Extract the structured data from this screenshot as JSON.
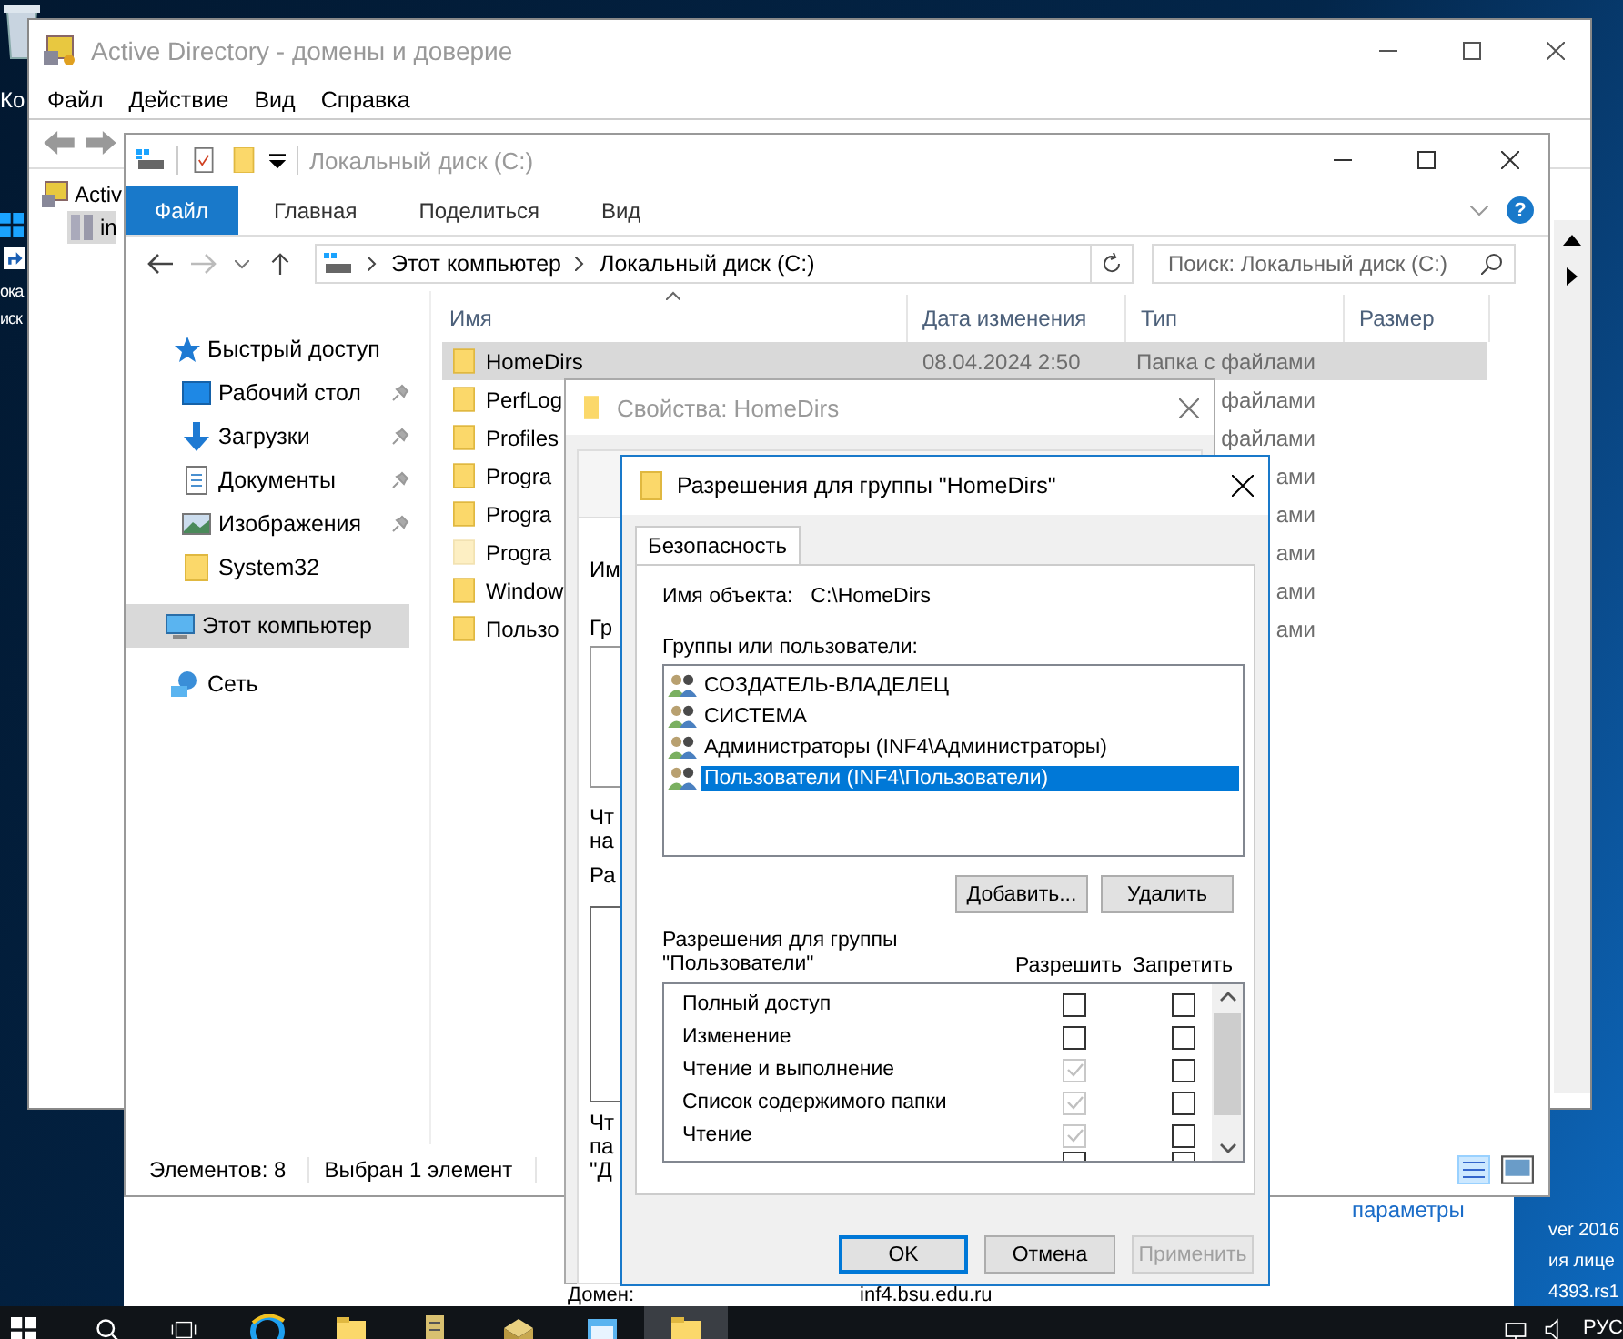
{
  "desktop": {
    "icon_labels": [
      "Ко",
      "ока",
      "иск"
    ],
    "system_text": [
      "ver 2016",
      "ия лице",
      "4393.rs1"
    ]
  },
  "ad_window": {
    "title": "Active Directory - домены и доверие",
    "menu": [
      "Файл",
      "Действие",
      "Вид",
      "Справка"
    ],
    "tree": [
      {
        "label": "Activ",
        "selected": false,
        "children": [
          {
            "label": "in",
            "selected": true
          }
        ]
      }
    ]
  },
  "back_window": {
    "link": "параметры",
    "fields": [
      {
        "label": "Домен:",
        "value": "inf4.bsu.edu.ru"
      }
    ]
  },
  "explorer": {
    "title": "Локальный диск (C:)",
    "ribbon_tabs": [
      {
        "label": "Файл",
        "selected": true
      },
      {
        "label": "Главная",
        "selected": false
      },
      {
        "label": "Поделиться",
        "selected": false
      },
      {
        "label": "Вид",
        "selected": false
      }
    ],
    "help": "?",
    "breadcrumb": [
      "Этот компьютер",
      "Локальный диск (C:)"
    ],
    "search": {
      "placeholder": "Поиск: Локальный диск (C:)"
    },
    "nav": [
      {
        "label": "Быстрый доступ",
        "kind": "star",
        "selected": false,
        "children": [
          {
            "label": "Рабочий стол",
            "kind": "desktop",
            "pinned": true
          },
          {
            "label": "Загрузки",
            "kind": "download",
            "pinned": true
          },
          {
            "label": "Документы",
            "kind": "documents",
            "pinned": true
          },
          {
            "label": "Изображения",
            "kind": "pictures",
            "pinned": true
          },
          {
            "label": "System32",
            "kind": "folder",
            "pinned": false
          }
        ]
      },
      {
        "label": "Этот компьютер",
        "kind": "computer",
        "selected": true
      },
      {
        "label": "Сеть",
        "kind": "network",
        "selected": false
      }
    ],
    "columns": [
      "Имя",
      "Дата изменения",
      "Тип",
      "Размер"
    ],
    "files": [
      {
        "name": "HomeDirs",
        "date": "08.04.2024 2:50",
        "type": "Папка с файлами",
        "selected": true,
        "hidden": false
      },
      {
        "name": "PerfLog",
        "type": "файлами",
        "selected": false,
        "hidden": false
      },
      {
        "name": "Profiles",
        "type": "файлами",
        "selected": false,
        "hidden": false
      },
      {
        "name": "Progra",
        "type": "ами",
        "selected": false,
        "hidden": false
      },
      {
        "name": "Progra",
        "type": "ами",
        "selected": false,
        "hidden": false
      },
      {
        "name": "Progra",
        "type": "ами",
        "selected": false,
        "hidden": true
      },
      {
        "name": "Window",
        "type": "ами",
        "selected": false,
        "hidden": false
      },
      {
        "name": "Пользо",
        "type": "ами",
        "selected": false,
        "hidden": false
      }
    ],
    "status": [
      "Элементов: 8",
      "Выбран 1 элемент"
    ]
  },
  "properties_dialog": {
    "title": "Свойства: HomeDirs",
    "fragments": [
      "Им",
      "Гр",
      "Чт",
      "на",
      "Ра",
      "Чт",
      "па",
      "\"Д"
    ]
  },
  "permissions_dialog": {
    "title": "Разрешения для группы \"HomeDirs\"",
    "tabs": [
      {
        "label": "Безопасность",
        "selected": true
      }
    ],
    "object_label": "Имя объекта:",
    "object_value": "C:\\HomeDirs",
    "groups_label": "Группы или пользователи:",
    "groups": [
      {
        "name": "СОЗДАТЕЛЬ-ВЛАДЕЛЕЦ",
        "selected": false
      },
      {
        "name": "СИСТЕМА",
        "selected": false
      },
      {
        "name": "Администраторы (INF4\\Администраторы)",
        "selected": false
      },
      {
        "name": "Пользователи (INF4\\Пользователи)",
        "selected": true
      }
    ],
    "list_buttons": [
      "Добавить...",
      "Удалить"
    ],
    "perm_label": "Разрешения для группы \"Пользователи\"",
    "allow_header": "Разрешить",
    "deny_header": "Запретить",
    "permissions": [
      {
        "name": "Полный доступ",
        "allow": false,
        "allow_disabled": false,
        "deny": false
      },
      {
        "name": "Изменение",
        "allow": false,
        "allow_disabled": false,
        "deny": false
      },
      {
        "name": "Чтение и выполнение",
        "allow": true,
        "allow_disabled": true,
        "deny": false
      },
      {
        "name": "Список содержимого папки",
        "allow": true,
        "allow_disabled": true,
        "deny": false
      },
      {
        "name": "Чтение",
        "allow": true,
        "allow_disabled": true,
        "deny": false
      }
    ],
    "buttons": [
      {
        "label": "OK",
        "default": true,
        "disabled": false
      },
      {
        "label": "Отмена",
        "default": false,
        "disabled": false
      },
      {
        "label": "Применить",
        "default": false,
        "disabled": true
      }
    ]
  },
  "taskbar": {
    "language": "РУС",
    "apps": [
      {
        "kind": "browser",
        "active": false
      },
      {
        "kind": "folder",
        "active": false
      },
      {
        "kind": "server",
        "active": false
      },
      {
        "kind": "box",
        "active": false
      },
      {
        "kind": "window",
        "active": false
      },
      {
        "kind": "folder",
        "active": true
      }
    ]
  }
}
